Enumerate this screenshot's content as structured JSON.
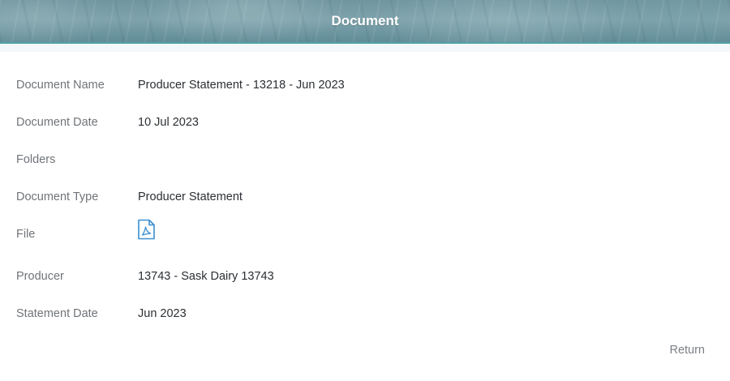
{
  "header": {
    "title": "Document"
  },
  "fields": [
    {
      "label": "Document Name",
      "value": "Producer Statement - 13218 - Jun 2023"
    },
    {
      "label": "Document Date",
      "value": "10 Jul 2023"
    },
    {
      "label": "Folders",
      "value": ""
    },
    {
      "label": "Document Type",
      "value": "Producer Statement"
    },
    {
      "label": "File",
      "icon": "pdf-file-icon"
    },
    {
      "label": "Producer",
      "value": "13743 - Sask Dairy 13743"
    },
    {
      "label": "Statement Date",
      "value": "Jun 2023"
    }
  ],
  "actions": {
    "return_label": "Return"
  },
  "colors": {
    "header_accent": "#4fa3a8",
    "icon_blue": "#3a8fd0",
    "label_gray": "#707479",
    "value_text": "#2b2f33"
  }
}
